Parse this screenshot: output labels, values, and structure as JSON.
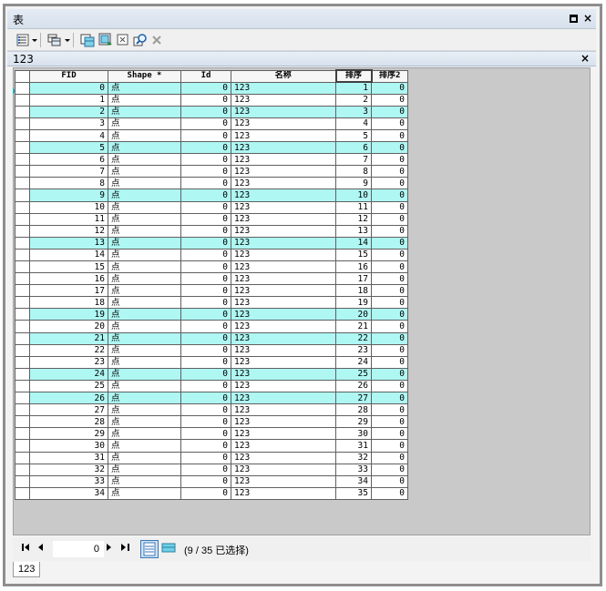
{
  "window": {
    "title": "表",
    "restore_label": "",
    "close_label": "×"
  },
  "table_tab": {
    "title": "123",
    "close_label": "×"
  },
  "columns": [
    "FID",
    "Shape *",
    "Id",
    "名称",
    "排序",
    "排序2"
  ],
  "rows": [
    {
      "fid": "0",
      "shape": "点",
      "id": "0",
      "name": "123",
      "sort": "1",
      "sort2": "0",
      "selected": true
    },
    {
      "fid": "1",
      "shape": "点",
      "id": "0",
      "name": "123",
      "sort": "2",
      "sort2": "0",
      "selected": false
    },
    {
      "fid": "2",
      "shape": "点",
      "id": "0",
      "name": "123",
      "sort": "3",
      "sort2": "0",
      "selected": true
    },
    {
      "fid": "3",
      "shape": "点",
      "id": "0",
      "name": "123",
      "sort": "4",
      "sort2": "0",
      "selected": false
    },
    {
      "fid": "4",
      "shape": "点",
      "id": "0",
      "name": "123",
      "sort": "5",
      "sort2": "0",
      "selected": false
    },
    {
      "fid": "5",
      "shape": "点",
      "id": "0",
      "name": "123",
      "sort": "6",
      "sort2": "0",
      "selected": true
    },
    {
      "fid": "6",
      "shape": "点",
      "id": "0",
      "name": "123",
      "sort": "7",
      "sort2": "0",
      "selected": false
    },
    {
      "fid": "7",
      "shape": "点",
      "id": "0",
      "name": "123",
      "sort": "8",
      "sort2": "0",
      "selected": false
    },
    {
      "fid": "8",
      "shape": "点",
      "id": "0",
      "name": "123",
      "sort": "9",
      "sort2": "0",
      "selected": false
    },
    {
      "fid": "9",
      "shape": "点",
      "id": "0",
      "name": "123",
      "sort": "10",
      "sort2": "0",
      "selected": true
    },
    {
      "fid": "10",
      "shape": "点",
      "id": "0",
      "name": "123",
      "sort": "11",
      "sort2": "0",
      "selected": false
    },
    {
      "fid": "11",
      "shape": "点",
      "id": "0",
      "name": "123",
      "sort": "12",
      "sort2": "0",
      "selected": false
    },
    {
      "fid": "12",
      "shape": "点",
      "id": "0",
      "name": "123",
      "sort": "13",
      "sort2": "0",
      "selected": false
    },
    {
      "fid": "13",
      "shape": "点",
      "id": "0",
      "name": "123",
      "sort": "14",
      "sort2": "0",
      "selected": true
    },
    {
      "fid": "14",
      "shape": "点",
      "id": "0",
      "name": "123",
      "sort": "15",
      "sort2": "0",
      "selected": false
    },
    {
      "fid": "15",
      "shape": "点",
      "id": "0",
      "name": "123",
      "sort": "16",
      "sort2": "0",
      "selected": false
    },
    {
      "fid": "16",
      "shape": "点",
      "id": "0",
      "name": "123",
      "sort": "17",
      "sort2": "0",
      "selected": false
    },
    {
      "fid": "17",
      "shape": "点",
      "id": "0",
      "name": "123",
      "sort": "18",
      "sort2": "0",
      "selected": false
    },
    {
      "fid": "18",
      "shape": "点",
      "id": "0",
      "name": "123",
      "sort": "19",
      "sort2": "0",
      "selected": false
    },
    {
      "fid": "19",
      "shape": "点",
      "id": "0",
      "name": "123",
      "sort": "20",
      "sort2": "0",
      "selected": true
    },
    {
      "fid": "20",
      "shape": "点",
      "id": "0",
      "name": "123",
      "sort": "21",
      "sort2": "0",
      "selected": false
    },
    {
      "fid": "21",
      "shape": "点",
      "id": "0",
      "name": "123",
      "sort": "22",
      "sort2": "0",
      "selected": true
    },
    {
      "fid": "22",
      "shape": "点",
      "id": "0",
      "name": "123",
      "sort": "23",
      "sort2": "0",
      "selected": false
    },
    {
      "fid": "23",
      "shape": "点",
      "id": "0",
      "name": "123",
      "sort": "24",
      "sort2": "0",
      "selected": false
    },
    {
      "fid": "24",
      "shape": "点",
      "id": "0",
      "name": "123",
      "sort": "25",
      "sort2": "0",
      "selected": true
    },
    {
      "fid": "25",
      "shape": "点",
      "id": "0",
      "name": "123",
      "sort": "26",
      "sort2": "0",
      "selected": false
    },
    {
      "fid": "26",
      "shape": "点",
      "id": "0",
      "name": "123",
      "sort": "27",
      "sort2": "0",
      "selected": true
    },
    {
      "fid": "27",
      "shape": "点",
      "id": "0",
      "name": "123",
      "sort": "28",
      "sort2": "0",
      "selected": false
    },
    {
      "fid": "28",
      "shape": "点",
      "id": "0",
      "name": "123",
      "sort": "29",
      "sort2": "0",
      "selected": false
    },
    {
      "fid": "29",
      "shape": "点",
      "id": "0",
      "name": "123",
      "sort": "30",
      "sort2": "0",
      "selected": false
    },
    {
      "fid": "30",
      "shape": "点",
      "id": "0",
      "name": "123",
      "sort": "31",
      "sort2": "0",
      "selected": false
    },
    {
      "fid": "31",
      "shape": "点",
      "id": "0",
      "name": "123",
      "sort": "32",
      "sort2": "0",
      "selected": false
    },
    {
      "fid": "32",
      "shape": "点",
      "id": "0",
      "name": "123",
      "sort": "33",
      "sort2": "0",
      "selected": false
    },
    {
      "fid": "33",
      "shape": "点",
      "id": "0",
      "name": "123",
      "sort": "34",
      "sort2": "0",
      "selected": false
    },
    {
      "fid": "34",
      "shape": "点",
      "id": "0",
      "name": "123",
      "sort": "35",
      "sort2": "0",
      "selected": false
    }
  ],
  "status": {
    "record_value": "0",
    "selection_text": "(9 / 35 已选择)"
  },
  "bottom_tab": {
    "label": "123"
  },
  "colors": {
    "selected_row": "#aef7f3",
    "title_bar": "#dce5f0",
    "delete_disabled": "#9b9b9b"
  },
  "icons": {
    "table_options": "table-options-icon",
    "related_tables": "related-tables-icon",
    "select_by_attributes": "select-by-attributes-icon",
    "switch_selection": "switch-selection-icon",
    "clear_selection": "clear-selection-icon",
    "zoom_to_selected": "zoom-to-selected-icon",
    "delete_selected": "delete-selected-icon"
  }
}
